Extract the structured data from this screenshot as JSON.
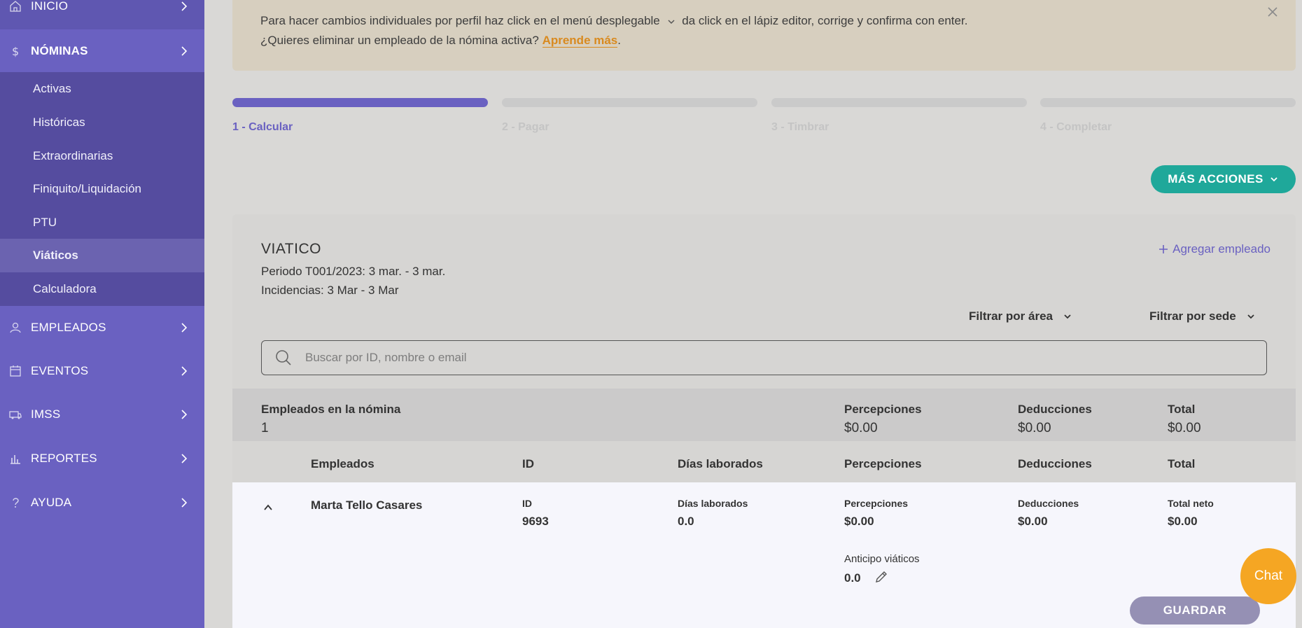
{
  "sidebar": {
    "top_item": "INICIO",
    "nominas": "NÓMINAS",
    "sub_items": [
      "Activas",
      "Históricas",
      "Extraordinarias",
      "Finiquito/Liquidación",
      "PTU",
      "Viáticos",
      "Calculadora"
    ],
    "active_sub": "Viáticos",
    "empleados": "EMPLEADOS",
    "eventos": "EVENTOS",
    "imss": "IMSS",
    "reportes": "REPORTES",
    "ayuda": "AYUDA"
  },
  "banner": {
    "line1_a": "Para hacer cambios individuales por perfil haz click en el menú desplegable",
    "line1_b": "da click en el lápiz editor, corrige y confirma con enter.",
    "line2_a": "¿Quieres eliminar un empleado de la nómina activa?",
    "line2_link": "Aprende más",
    "line2_end": "."
  },
  "steps": [
    "1 - Calcular",
    "2 - Pagar",
    "3 - Timbrar",
    "4 - Completar"
  ],
  "more_actions": "MÁS ACCIONES",
  "card": {
    "title": "VIATICO",
    "period": "Periodo T001/2023: 3 mar. - 3 mar.",
    "incidences": "Incidencias: 3 Mar - 3 Mar",
    "add_employee": "Agregar empleado",
    "filter_area": "Filtrar por área",
    "filter_site": "Filtrar por sede",
    "search_placeholder": "Buscar por ID, nombre o email"
  },
  "summary": {
    "employees_label": "Empleados en la nómina",
    "employees_value": "1",
    "perceptions_label": "Percepciones",
    "perceptions_value": "$0.00",
    "deductions_label": "Deducciones",
    "deductions_value": "$0.00",
    "total_label": "Total",
    "total_value": "$0.00"
  },
  "table_headers": {
    "employees": "Empleados",
    "id": "ID",
    "days": "Días laborados",
    "perceptions": "Percepciones",
    "deductions": "Deducciones",
    "total": "Total"
  },
  "row": {
    "name": "Marta Tello Casares",
    "id_label": "ID",
    "id_value": "9693",
    "days_label": "Días laborados",
    "days_value": "0.0",
    "perceptions_label": "Percepciones",
    "perceptions_value": "$0.00",
    "deductions_label": "Deducciones",
    "deductions_value": "$0.00",
    "total_label": "Total neto",
    "total_value": "$0.00",
    "advance_label": "Anticipo viáticos",
    "advance_value": "0.0",
    "save": "GUARDAR"
  },
  "chat": "Chat"
}
